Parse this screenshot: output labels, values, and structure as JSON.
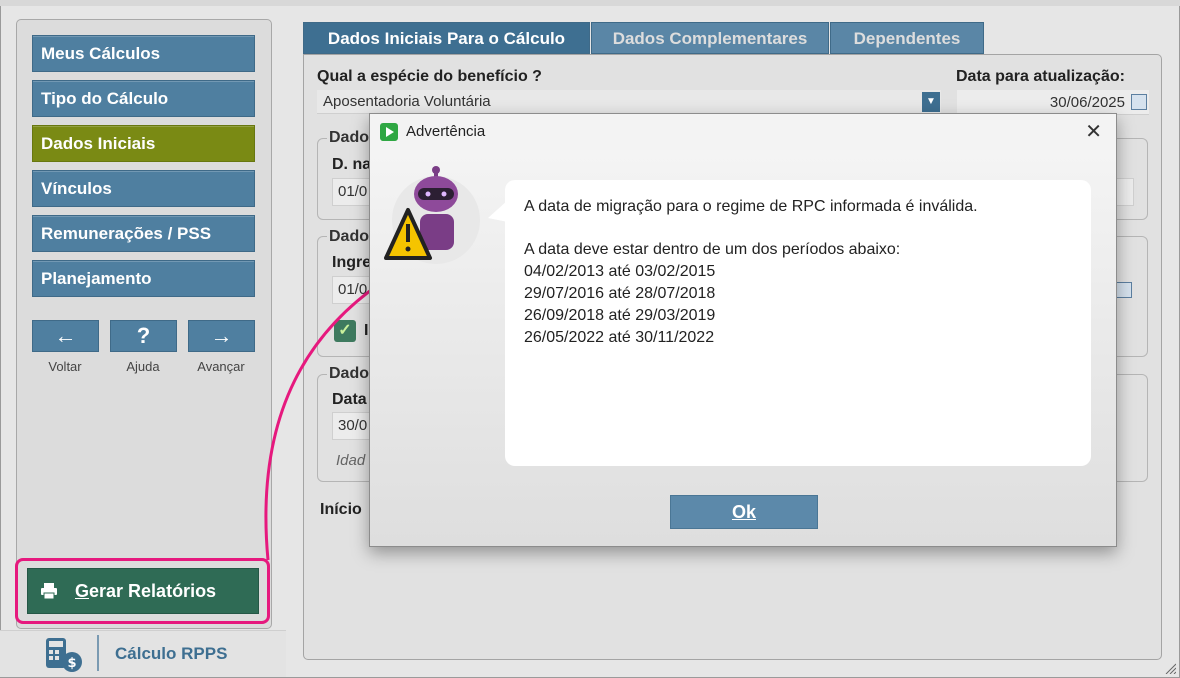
{
  "sidebar": {
    "items": [
      {
        "label": "Meus Cálculos"
      },
      {
        "label": "Tipo do Cálculo"
      },
      {
        "label": "Dados Iniciais"
      },
      {
        "label": "Vínculos"
      },
      {
        "label": "Remunerações / PSS"
      },
      {
        "label": "Planejamento"
      }
    ],
    "nav": {
      "back": {
        "glyph": "←",
        "label": "Voltar"
      },
      "help": {
        "glyph": "?",
        "label": "Ajuda"
      },
      "forward": {
        "glyph": "→",
        "label": "Avançar"
      }
    },
    "report_button": {
      "label_underlined": "G",
      "label_rest": "erar Relatórios"
    },
    "brand": "Cálculo RPPS"
  },
  "tabs": [
    {
      "label": "Dados Iniciais Para o Cálculo"
    },
    {
      "label": "Dados Complementares"
    },
    {
      "label": "Dependentes"
    }
  ],
  "form": {
    "especie_label": "Qual a espécie do benefício ?",
    "especie_value": "Aposentadoria Voluntária",
    "data_atualizacao_label": "Data para atualização:",
    "data_atualizacao_value": "30/06/2025",
    "group1_title": "Dado",
    "group1_field_label": "D. na",
    "group1_field_value": "01/0",
    "group2_title": "Dado",
    "group2_field_label": "Ingre",
    "group2_field_value": "01/0",
    "group2_check_label": "I",
    "group3_title": "Dado",
    "group3_field_label": "Data",
    "group3_field_value": "30/0",
    "group3_italic": "Idad",
    "inicio_label": "Início"
  },
  "dialog": {
    "title": "Advertência",
    "close": "✕",
    "line1": "A data de migração para o regime de RPC informada é inválida.",
    "line2": "A data deve estar dentro de um dos períodos abaixo:",
    "periods": [
      "04/02/2013 até 03/02/2015",
      "29/07/2016 até 28/07/2018",
      "26/09/2018 até 29/03/2019",
      "26/05/2022 até 30/11/2022"
    ],
    "ok_underlined": "Ok"
  },
  "colors": {
    "nav_blue": "#4f7fa0",
    "active_green": "#7a8a14",
    "report_green": "#2f6b55",
    "highlight_pink": "#e6197e"
  }
}
